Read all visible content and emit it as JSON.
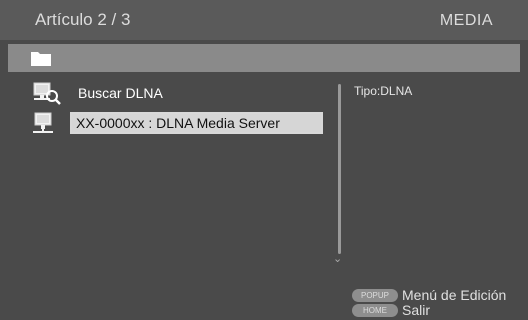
{
  "header": {
    "title": "Artículo 2 / 3",
    "section": "MEDIA"
  },
  "pathbar": {
    "icon": "folder-icon"
  },
  "list": {
    "items": [
      {
        "label": "Buscar DLNA",
        "icon": "search-network-icon"
      },
      {
        "label": "XX-0000xx : DLNA Media Server",
        "icon": "network-server-icon",
        "selected": true
      }
    ]
  },
  "info": {
    "type_text": "Tipo:DLNA"
  },
  "hints": [
    {
      "key": "POPUP",
      "label": "Menú de Edición"
    },
    {
      "key": "HOME",
      "label": "Salir"
    }
  ],
  "colors": {
    "background": "#4a4a4a",
    "header": "#5a5a5a",
    "pathbar": "#8a8a8a",
    "selection": "#d6d6d6"
  }
}
